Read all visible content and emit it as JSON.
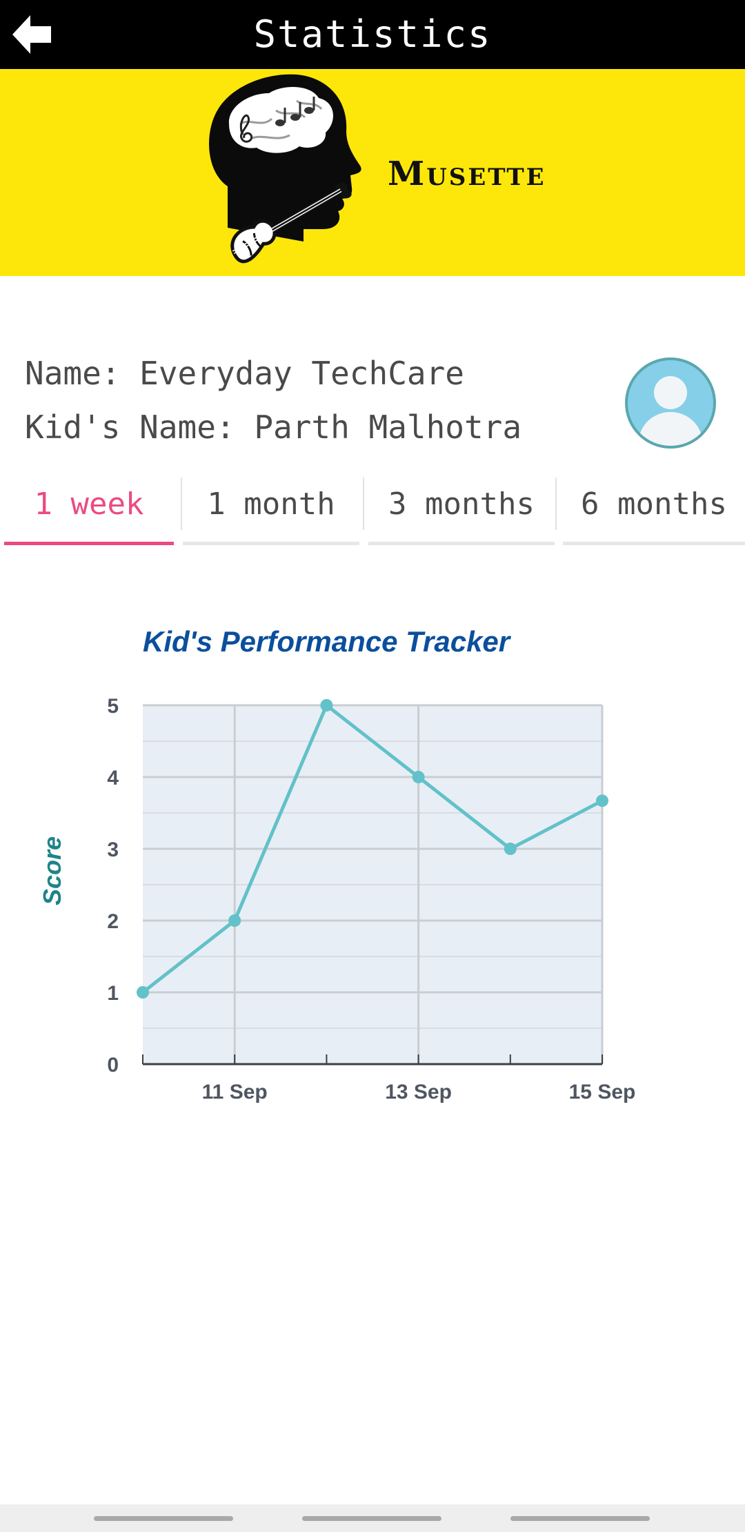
{
  "header": {
    "title": "Statistics",
    "back_icon": "back-arrow-icon"
  },
  "banner": {
    "background": "#fde70a",
    "logo_text": "Musette",
    "logo_icon": "musician-head-violin-logo"
  },
  "profile": {
    "name_line": "Name: Everyday TechCare",
    "kid_line": "Kid's Name: Parth Malhotra",
    "avatar_icon": "user-avatar-icon"
  },
  "tabs": [
    {
      "label": "1 week",
      "active": true
    },
    {
      "label": "1 month",
      "active": false
    },
    {
      "label": "3 months",
      "active": false
    },
    {
      "label": "6 months",
      "active": false
    }
  ],
  "colors": {
    "accent": "#ec4a82",
    "line": "#62c1c9",
    "chart_title": "#0b4f9c",
    "ylabel": "#1e8489",
    "plot_bg": "#e8eef5"
  },
  "chart_data": {
    "type": "line",
    "title": "Kid's Performance Tracker",
    "ylabel": "Score",
    "xlabel": "",
    "x": [
      "10 Sep",
      "11 Sep",
      "12 Sep",
      "13 Sep",
      "14 Sep",
      "15 Sep"
    ],
    "x_tick_labels": [
      "11 Sep",
      "13 Sep",
      "15 Sep"
    ],
    "ylim": [
      0,
      5
    ],
    "y_ticks": [
      0,
      1,
      2,
      3,
      4,
      5
    ],
    "grid": true,
    "series": [
      {
        "values": [
          1,
          2,
          5,
          4,
          3,
          3.67
        ]
      }
    ]
  }
}
